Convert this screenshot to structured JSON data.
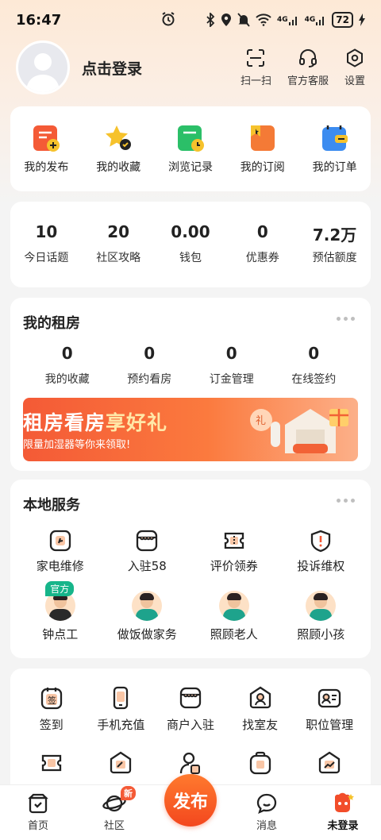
{
  "status": {
    "time": "16:47",
    "network_4g_a": "4G",
    "network_4g_b": "4G",
    "battery": "72"
  },
  "profile": {
    "login_text": "点击登录",
    "actions": [
      {
        "label": "扫一扫",
        "icon": "scan-icon"
      },
      {
        "label": "官方客服",
        "icon": "headset-icon"
      },
      {
        "label": "设置",
        "icon": "settings-icon"
      }
    ]
  },
  "quick": [
    {
      "label": "我的发布",
      "icon": "my-posts-icon"
    },
    {
      "label": "我的收藏",
      "icon": "star-icon"
    },
    {
      "label": "浏览记录",
      "icon": "history-icon"
    },
    {
      "label": "我的订阅",
      "icon": "subscription-icon"
    },
    {
      "label": "我的订单",
      "icon": "orders-icon"
    }
  ],
  "stats": [
    {
      "num": "10",
      "label": "今日话题"
    },
    {
      "num": "20",
      "label": "社区攻略"
    },
    {
      "num": "0.00",
      "label": "钱包"
    },
    {
      "num": "0",
      "label": "优惠券"
    },
    {
      "num": "7.2万",
      "label": "预估额度"
    }
  ],
  "rent": {
    "title": "我的租房",
    "items": [
      {
        "num": "0",
        "label": "我的收藏"
      },
      {
        "num": "0",
        "label": "预约看房"
      },
      {
        "num": "0",
        "label": "订金管理"
      },
      {
        "num": "0",
        "label": "在线签约"
      }
    ],
    "banner_title_a": "租房看房",
    "banner_title_b": "享好礼",
    "banner_sub": "限量加湿器等你来领取!",
    "gift_char": "礼"
  },
  "local": {
    "title": "本地服务",
    "row1": [
      {
        "label": "家电维修",
        "icon": "repair-icon"
      },
      {
        "label": "入驻58",
        "icon": "shop-icon"
      },
      {
        "label": "评价领券",
        "icon": "coupon-icon"
      },
      {
        "label": "投诉维权",
        "icon": "complaint-icon"
      }
    ],
    "row2": [
      {
        "label": "钟点工",
        "badge": "官方"
      },
      {
        "label": "做饭做家务"
      },
      {
        "label": "照顾老人"
      },
      {
        "label": "照顾小孩"
      }
    ]
  },
  "tools": {
    "row1": [
      {
        "label": "签到",
        "icon": "signin-icon",
        "glyph": "签"
      },
      {
        "label": "手机充值",
        "icon": "phone-recharge-icon"
      },
      {
        "label": "商户入驻",
        "icon": "merchant-icon"
      },
      {
        "label": "找室友",
        "icon": "roommate-icon"
      },
      {
        "label": "职位管理",
        "icon": "job-icon"
      }
    ]
  },
  "nav": [
    {
      "label": "首页",
      "icon": "home-icon"
    },
    {
      "label": "社区",
      "icon": "community-icon",
      "badge": "新"
    },
    {
      "label": "发布",
      "icon": "publish-icon"
    },
    {
      "label": "消息",
      "icon": "message-icon"
    },
    {
      "label": "未登录",
      "icon": "user-icon"
    }
  ],
  "colors": {
    "accent": "#f45a36",
    "green": "#16b58a",
    "yellow": "#f6c22c"
  }
}
